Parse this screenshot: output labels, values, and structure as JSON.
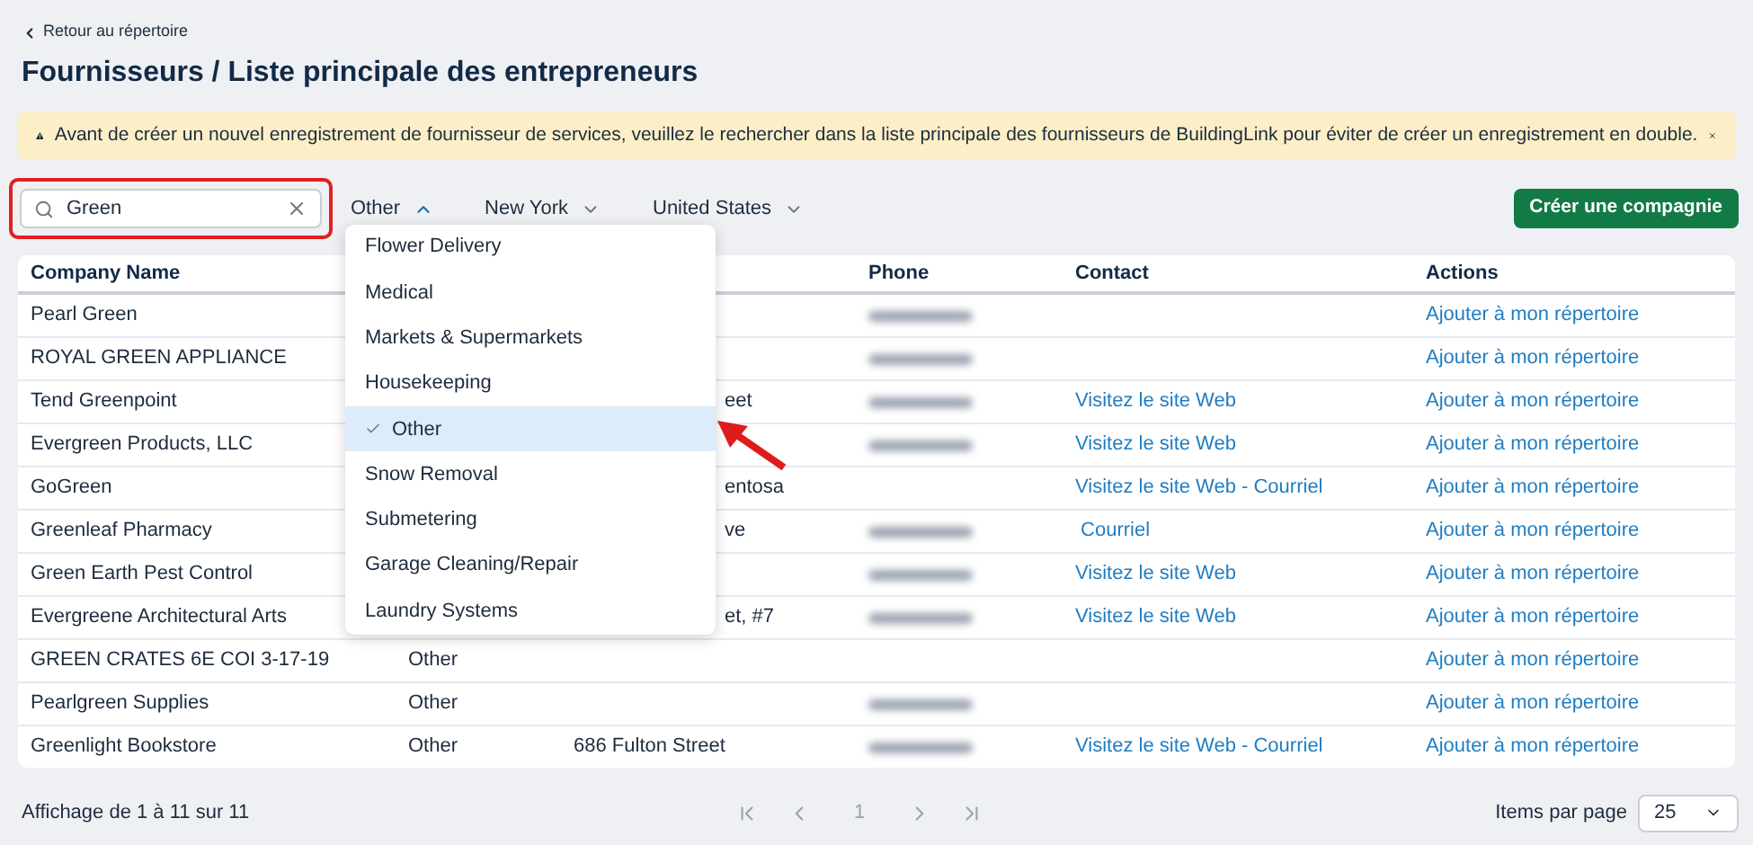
{
  "back_link": "Retour au répertoire",
  "title": "Fournisseurs / Liste principale des entrepreneurs",
  "banner": {
    "text": "Avant de créer un nouvel enregistrement de fournisseur de services, veuillez le rechercher dans la liste principale des fournisseurs de BuildingLink pour éviter de créer un enregistrement en double."
  },
  "search": {
    "value": "Green",
    "highlighted": true
  },
  "filters": [
    {
      "label": "Other",
      "expanded": true
    },
    {
      "label": "New York",
      "expanded": false
    },
    {
      "label": "United States",
      "expanded": false
    }
  ],
  "create_button": "Créer une compagnie",
  "category_menu": [
    {
      "label": "Flower Delivery",
      "selected": false
    },
    {
      "label": "Medical",
      "selected": false
    },
    {
      "label": "Markets & Supermarkets",
      "selected": false
    },
    {
      "label": "Housekeeping",
      "selected": false
    },
    {
      "label": "Other",
      "selected": true
    },
    {
      "label": "Snow Removal",
      "selected": false
    },
    {
      "label": "Submetering",
      "selected": false
    },
    {
      "label": "Garage Cleaning/Repair",
      "selected": false
    },
    {
      "label": "Laundry Systems",
      "selected": false
    }
  ],
  "pointer_arrow": true,
  "table": {
    "columns": [
      "Company Name",
      "Phone",
      "Contact",
      "Actions"
    ],
    "rows": [
      {
        "company": "Pearl Green",
        "phone_shown": true,
        "action": "Ajouter à mon répertoire"
      },
      {
        "company": "ROYAL GREEN APPLIANCE",
        "phone_shown": true,
        "action": "Ajouter à mon répertoire"
      },
      {
        "company": "Tend Greenpoint",
        "address": "eet",
        "covered": true,
        "phone_shown": true,
        "contact": "Visitez le site Web",
        "action": "Ajouter à mon répertoire"
      },
      {
        "company": "Evergreen Products, LLC",
        "phone_shown": true,
        "contact": "Visitez le site Web",
        "action": "Ajouter à mon répertoire"
      },
      {
        "company": "GoGreen",
        "address": "entosa",
        "covered": true,
        "phone_shown": false,
        "contact": "Visitez le site Web - Courriel",
        "action": "Ajouter à mon répertoire"
      },
      {
        "company": "Greenleaf Pharmacy",
        "address": "ve",
        "covered": true,
        "phone_shown": true,
        "contact": " Courriel",
        "action": "Ajouter à mon répertoire"
      },
      {
        "company": "Green Earth Pest Control",
        "phone_shown": true,
        "contact": "Visitez le site Web",
        "action": "Ajouter à mon répertoire"
      },
      {
        "company": "Evergreene Architectural Arts",
        "address": "et, #7",
        "covered": true,
        "phone_shown": true,
        "contact": "Visitez le site Web",
        "action": "Ajouter à mon répertoire"
      },
      {
        "company": "GREEN CRATES 6E COI 3-17-19",
        "category": "Other",
        "phone_shown": false,
        "action": "Ajouter à mon répertoire"
      },
      {
        "company": "Pearlgreen Supplies",
        "category": "Other",
        "phone_shown": true,
        "action": "Ajouter à mon répertoire"
      },
      {
        "company": "Greenlight Bookstore",
        "category": "Other",
        "address": "686 Fulton Street",
        "covered": false,
        "phone_shown": true,
        "contact": "Visitez le site Web - Courriel",
        "action": "Ajouter à mon répertoire"
      }
    ]
  },
  "footer": {
    "summary": "Affichage de 1 à 11 sur 11",
    "page": "1",
    "items_label": "Items par page",
    "items_value": "25"
  }
}
